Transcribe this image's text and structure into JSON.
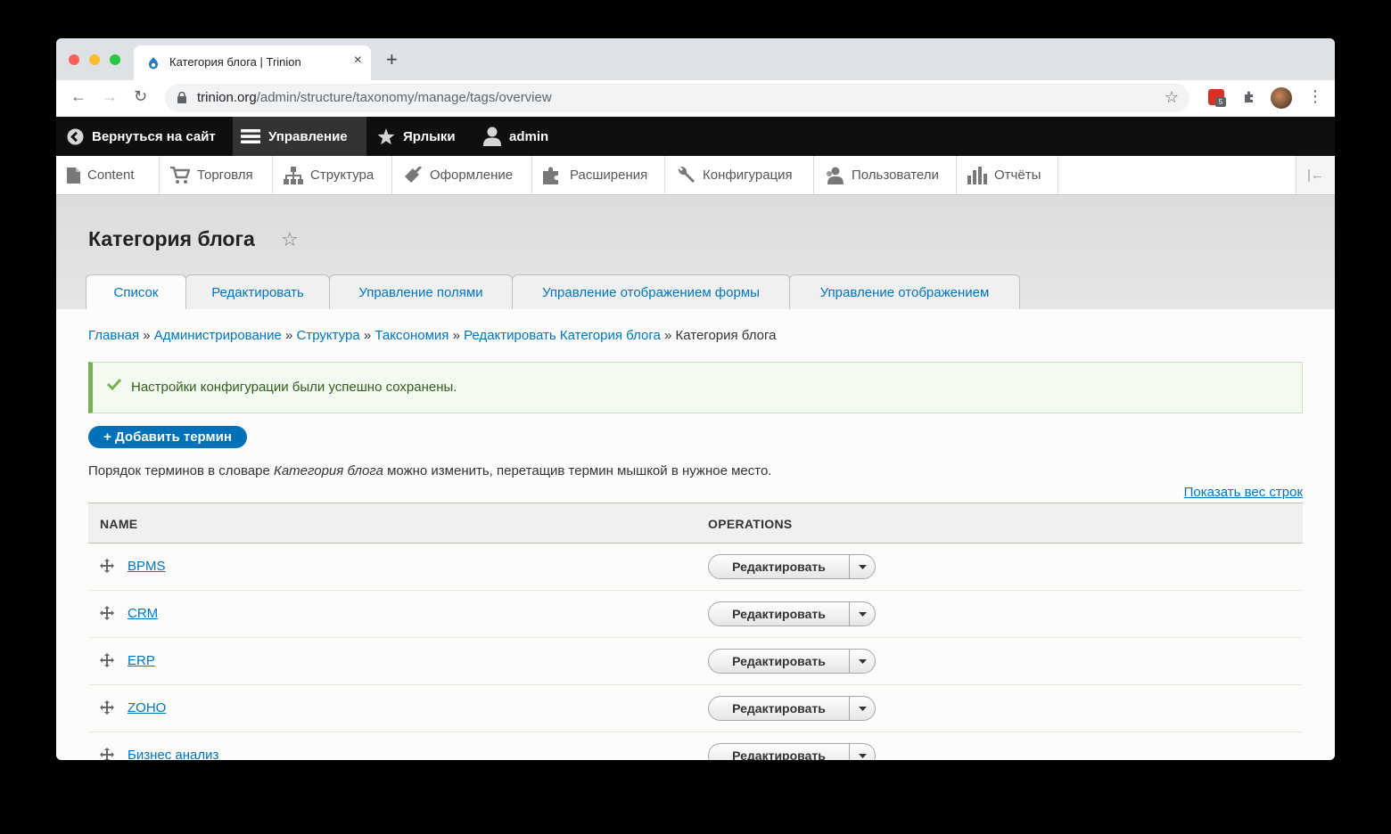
{
  "browser": {
    "tab_title": "Категория блога | Trinion",
    "tab_close": "×",
    "new_tab": "+",
    "url_host": "trinion.org",
    "url_path": "/admin/structure/taxonomy/manage/tags/overview",
    "extension_badge": "5"
  },
  "admin_toolbar": {
    "back": "Вернуться на сайт",
    "manage": "Управление",
    "shortcuts": "Ярлыки",
    "user": "admin"
  },
  "tray": {
    "items": [
      "Content",
      "Торговля",
      "Структура",
      "Оформление",
      "Расширения",
      "Конфигурация",
      "Пользователи",
      "Отчёты"
    ]
  },
  "page": {
    "title": "Категория блога",
    "tabs": [
      "Список",
      "Редактировать",
      "Управление полями",
      "Управление отображением формы",
      "Управление отображением"
    ]
  },
  "breadcrumb": {
    "links": [
      "Главная",
      "Администрирование",
      "Структура",
      "Таксономия",
      "Редактировать Категория блога"
    ],
    "separator": "»",
    "current": "Категория блога"
  },
  "status_message": "Настройки конфигурации были успешно сохранены.",
  "add_term_button": "+ Добавить термин",
  "help": {
    "before": "Порядок терминов в словаре ",
    "vocab": "Категория блога",
    "after": " можно изменить, перетащив термин мышкой в нужное место."
  },
  "show_weights": "Показать вес строк",
  "table": {
    "col_name": "NAME",
    "col_operations": "OPERATIONS",
    "operation_label": "Редактировать",
    "rows": [
      "BPMS",
      "CRM",
      "ERP",
      "ZOHO",
      "Бизнес анализ"
    ]
  },
  "colors": {
    "link": "#0074bd",
    "toolbar_bg": "#0f0f0f",
    "status_border": "#77b259",
    "button_primary": "#0071b8"
  }
}
